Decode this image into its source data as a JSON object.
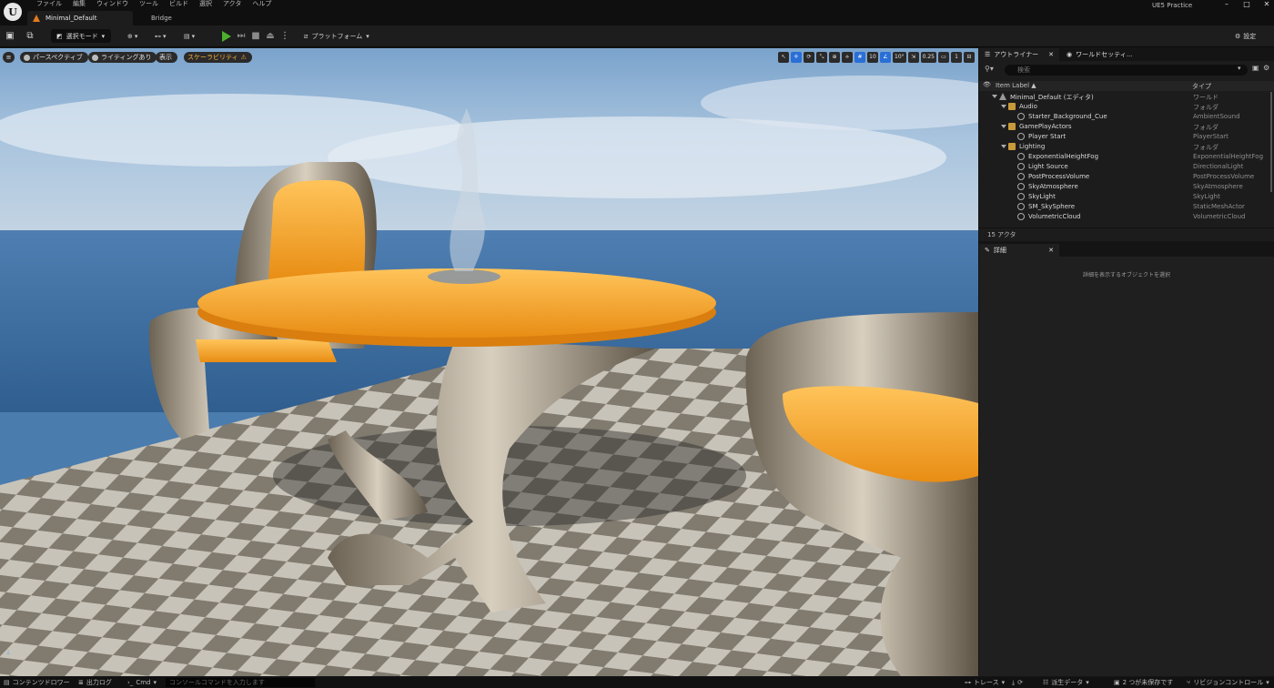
{
  "app": {
    "project_name": "UE5 Practice",
    "level_tab": "Minimal_Default",
    "bridge_tab": "Bridge",
    "menus": [
      "ファイル",
      "編集",
      "ウィンドウ",
      "ツール",
      "ビルド",
      "選択",
      "アクタ",
      "ヘルプ"
    ],
    "window_controls": [
      "–",
      "□",
      "✕"
    ]
  },
  "toolbar": {
    "mode_label": "選択モード",
    "platform_label": "プラットフォーム",
    "settings_label": "設定"
  },
  "viewport": {
    "perspective_label": "パースペクティブ",
    "lighting_label": "ライティングあり",
    "show_label": "表示",
    "scalability_label": "スケーラビリティ",
    "grid_snap": "10",
    "rotation_snap": "10°",
    "scale_snap": "0.25",
    "camera_speed": "1"
  },
  "outliner": {
    "tab_label": "アウトライナー",
    "world_settings_tab": "ワールドセッティ...",
    "search_placeholder": "検索",
    "col_label": "Item Label ▲",
    "col_type": "タイプ",
    "rows": [
      {
        "name": "Minimal_Default (エディタ)",
        "type": "ワールド",
        "indent": 0,
        "kind": "world"
      },
      {
        "name": "Audio",
        "type": "フォルダ",
        "indent": 1,
        "kind": "folder"
      },
      {
        "name": "Starter_Background_Cue",
        "type": "AmbientSound",
        "indent": 2,
        "kind": "actor"
      },
      {
        "name": "GamePlayActors",
        "type": "フォルダ",
        "indent": 1,
        "kind": "folder"
      },
      {
        "name": "Player Start",
        "type": "PlayerStart",
        "indent": 2,
        "kind": "actor"
      },
      {
        "name": "Lighting",
        "type": "フォルダ",
        "indent": 1,
        "kind": "folder"
      },
      {
        "name": "ExponentialHeightFog",
        "type": "ExponentialHeightFog",
        "indent": 2,
        "kind": "actor"
      },
      {
        "name": "Light Source",
        "type": "DirectionalLight",
        "indent": 2,
        "kind": "actor"
      },
      {
        "name": "PostProcessVolume",
        "type": "PostProcessVolume",
        "indent": 2,
        "kind": "actor"
      },
      {
        "name": "SkyAtmosphere",
        "type": "SkyAtmosphere",
        "indent": 2,
        "kind": "actor"
      },
      {
        "name": "SkyLight",
        "type": "SkyLight",
        "indent": 2,
        "kind": "actor"
      },
      {
        "name": "SM_SkySphere",
        "type": "StaticMeshActor",
        "indent": 2,
        "kind": "actor"
      },
      {
        "name": "VolumetricCloud",
        "type": "VolumetricCloud",
        "indent": 2,
        "kind": "actor"
      }
    ],
    "actor_count": "15 アクタ"
  },
  "details": {
    "tab_label": "詳細",
    "empty_message": "詳細を表示するオブジェクトを選択"
  },
  "statusbar": {
    "content_drawer": "コンテンツドロワー",
    "output_log": "出力ログ",
    "cmd_label": "Cmd",
    "cmd_placeholder": "コンソールコマンドを入力します",
    "trace": "トレース",
    "derived_data": "派生データ",
    "unsaved": "2 つが未保存です",
    "source_control": "リビジョンコントロール"
  },
  "colors": {
    "accent": "#2a6fd6",
    "play": "#4caf2e",
    "scalability": "#ffb340",
    "folder": "#c79a3a"
  }
}
